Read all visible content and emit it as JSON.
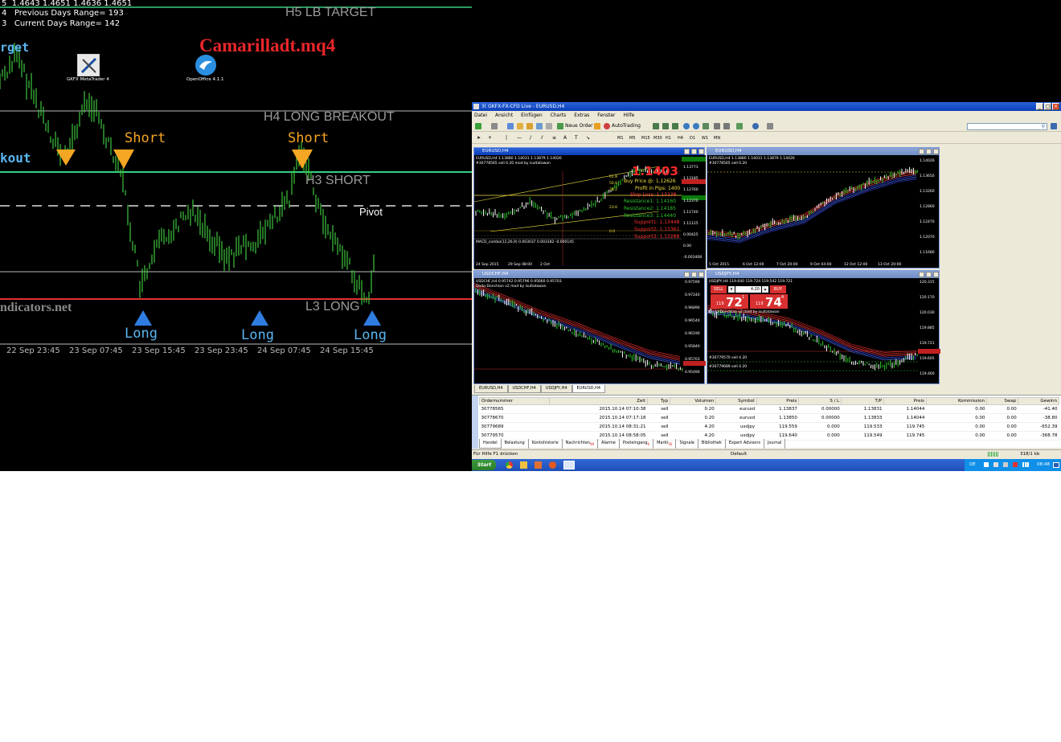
{
  "left": {
    "ohlc": "1.4643 1.4651 1.4636 1.4651",
    "ohlc_prefix": "5",
    "prev_range": "Previous Days Range= 193",
    "prev_prefix": "4",
    "curr_range": "Current Days Range= 142",
    "curr_prefix": "3",
    "target": "rget",
    "title": "Camarilladt.mq4",
    "h5": "H5 LB TARGET",
    "h4": "H4 LONG BREAKOUT",
    "h3": "H3 SHORT",
    "pivot": "Pivot",
    "l3": "L3 LONG",
    "breakout": "kout",
    "site": "ndicators.net",
    "short": "Short",
    "long": "Long",
    "icon1_label": "GKFX MetaTrader 4",
    "icon2_label": "OpenOffice 4.1.1",
    "times": [
      "22 Sep 23:45",
      "23 Sep 07:45",
      "23 Sep 15:45",
      "23 Sep 23:45",
      "24 Sep 07:45",
      "24 Sep 15:45"
    ],
    "colors": {
      "short_arrow": "#f5a623",
      "long_arrow": "#2f7de1",
      "line_green": "#35d07f",
      "line_red": "#e03030",
      "candle": "#3ec43e"
    }
  },
  "mt4": {
    "window_title": "GKFX-FX-CFD Live - EURUSD,H4",
    "window_prefix": "3(",
    "menu": [
      "Datei",
      "Ansicht",
      "Einfügen",
      "Charts",
      "Extras",
      "Fenster",
      "Hilfe"
    ],
    "new_order": "Neue Order",
    "autotrading": "AutoTrading",
    "timeframes": [
      "M1",
      "M5",
      "M15",
      "M30",
      "H1",
      "H4",
      "D1",
      "W1",
      "MN"
    ],
    "charts": [
      {
        "title": "EURUSD,H4",
        "info": "EURUSD,H4  1.13880 1.14031 1.13879 1.14026",
        "sub": "#30778565 sell 0.20",
        "sub2": "mod by isultatawan",
        "price_big": "1.1403",
        "buy_price": "Buy Price @: 1.12626",
        "profit": "Profit in Pips: 1400",
        "stoploss": "Stop Loss: 1.13238",
        "res1": "Resistance1: 1.14160",
        "res2": "Resistance2: 1.14185",
        "res3": "Resistance3: 1.14440",
        "sup1": "Support1: 1.13448",
        "sup2": "Support2: 1.13361",
        "sup3": "Support3: 1.13288",
        "fib": [
          "61.8",
          "50.0",
          "38.2",
          "23.6",
          "0.0"
        ],
        "macd": "MACD_combo(12,26,9) 0.003037 0.003182 -0.000145",
        "axis": [
          "1.13773",
          "1.13185",
          "1.12760",
          "1.12370",
          "1.11740",
          "1.11125",
          "0.00425",
          "0.00",
          "-0.003408"
        ],
        "times": [
          "24 Sep 2015",
          "29 Sep 08:00",
          "2 Oct"
        ]
      },
      {
        "title": "EURUSD,H4",
        "info": "EURUSD,H4  1.13880 1.14031 1.13879 1.14026",
        "sub": "#30778565 sell 0.20",
        "sub2": "Dodo-Donchian v2 mod by isultatawan",
        "axis": [
          "1.14026",
          "1.13650",
          "1.13260",
          "1.12860",
          "1.12470",
          "1.12070",
          "1.11680"
        ],
        "times": [
          "5 Oct 2015",
          "6 Oct 12:00",
          "7 Oct 20:00",
          "9 Oct 04:00",
          "12 Oct 12:00",
          "13 Oct 20:00"
        ]
      },
      {
        "title": "USDCHF,H4",
        "info": "USDCHF,H4  0.95742 0.95796 0.95660 0.95703",
        "sub2": "Dodo-Donchian v2 mod by isultatawan",
        "axis": [
          "0.97590",
          "0.97240",
          "0.96890",
          "0.96540",
          "0.96190",
          "0.95840",
          "0.95703",
          "0.95490"
        ]
      },
      {
        "title": "USDJPY,H4",
        "info": "USDJPY,H4  119.640 119.724 119.542 119.721",
        "sub2": "Dodo-Donchian v2 mod by isultatawan",
        "sell": "SELL",
        "buy": "BUY",
        "lot": "4.20",
        "bid_pre": "119",
        "bid_big": "72",
        "bid_sup": "1",
        "ask_pre": "119",
        "ask_big": "74",
        "ask_sup": "4",
        "order1": "#30779570 sell 4.20",
        "order2": "#30779689 sell 4.20",
        "axis": [
          "120.315",
          "120.170",
          "120.030",
          "119.885",
          "119.721",
          "119.605",
          "119.460"
        ]
      }
    ],
    "chart_tabs": [
      "EURUSD,H4",
      "USDCHF,H4",
      "USDJPY,H4",
      "EURUSD,H4"
    ],
    "terminal": {
      "side_label": "Terminal",
      "headers": [
        "Ordernummer",
        "Zeit",
        "Typ",
        "Volumen",
        "Symbol",
        "Preis",
        "S / L",
        "T/P",
        "Preis",
        "Kommission",
        "Swap",
        "Gewinn"
      ],
      "rows": [
        [
          "30778565",
          "2015.10.14 07:10:38",
          "sell",
          "0.20",
          "eurusd",
          "1.13837",
          "0.00000",
          "1.13831",
          "1.14044",
          "0.00",
          "0.00",
          "-41.40"
        ],
        [
          "30778670",
          "2015.10.14 07:17:18",
          "sell",
          "0.20",
          "eurusd",
          "1.13850",
          "0.00000",
          "1.13833",
          "1.14044",
          "0.00",
          "0.00",
          "-38.80"
        ],
        [
          "30779689",
          "2015.10.14 08:31:21",
          "sell",
          "4.20",
          "usdjpy",
          "119.559",
          "0.000",
          "119.533",
          "119.745",
          "0.00",
          "0.00",
          "-652.39"
        ],
        [
          "30779570",
          "2015.10.14 08:58:05",
          "sell",
          "4.20",
          "usdjpy",
          "119.640",
          "0.000",
          "119.549",
          "119.745",
          "0.00",
          "0.00",
          "-368.78"
        ]
      ],
      "tabs": [
        "Handel",
        "Belastung",
        "Kontohistorie",
        "Nachrichten",
        "Alarme",
        "Posteingang",
        "Markt",
        "Signale",
        "Bibliothek",
        "Expert Advisors",
        "Journal"
      ],
      "badge_news": "99",
      "badge_inbox": "6",
      "badge_market": "50"
    },
    "status": {
      "help": "Für Hilfe F1 drücken",
      "profile": "Default",
      "traffic": "318/1 kb"
    },
    "taskbar": {
      "start": "Start",
      "lang": "DE",
      "clock": "08:48"
    }
  }
}
